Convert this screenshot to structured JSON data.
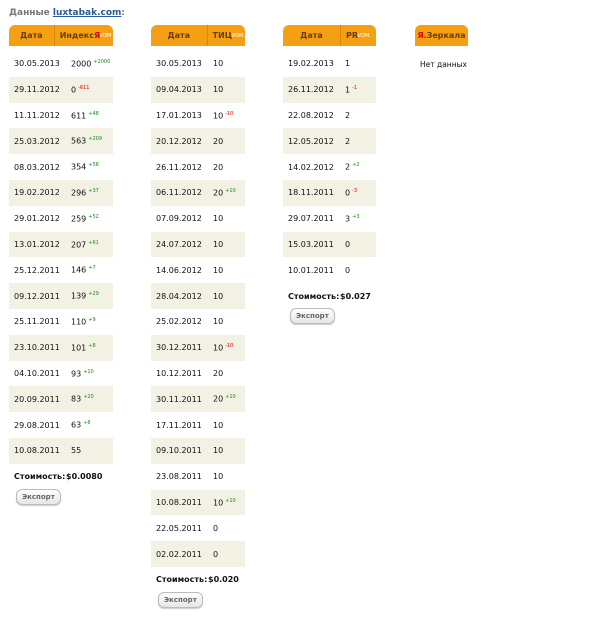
{
  "title": {
    "prefix": "Данные",
    "domain": "luxtabak.com",
    "suffix": ":"
  },
  "tables": [
    {
      "h1": "Дата",
      "h2": "Индекс",
      "h2_ya": "Я",
      "sup": "ИЗМ.",
      "cost_label": "Стоимость:",
      "cost": "$0.0080",
      "export": "Экспорт",
      "rows": [
        [
          "30.05.2013",
          "2000",
          "+2000"
        ],
        [
          "29.11.2012",
          "0",
          "-611"
        ],
        [
          "11.11.2012",
          "611",
          "+48"
        ],
        [
          "25.03.2012",
          "563",
          "+209"
        ],
        [
          "08.03.2012",
          "354",
          "+58"
        ],
        [
          "19.02.2012",
          "296",
          "+37"
        ],
        [
          "29.01.2012",
          "259",
          "+52"
        ],
        [
          "13.01.2012",
          "207",
          "+61"
        ],
        [
          "25.12.2011",
          "146",
          "+7"
        ],
        [
          "09.12.2011",
          "139",
          "+29"
        ],
        [
          "25.11.2011",
          "110",
          "+9"
        ],
        [
          "23.10.2011",
          "101",
          "+8"
        ],
        [
          "04.10.2011",
          "93",
          "+10"
        ],
        [
          "20.09.2011",
          "83",
          "+20"
        ],
        [
          "29.08.2011",
          "63",
          "+8"
        ],
        [
          "10.08.2011",
          "55",
          ""
        ]
      ]
    },
    {
      "h1": "Дата",
      "h2": "ТИЦ",
      "h2_ya": "",
      "sup": "ИЗМ.",
      "cost_label": "Стоимость:",
      "cost": "$0.020",
      "export": "Экспорт",
      "rows": [
        [
          "30.05.2013",
          "10",
          ""
        ],
        [
          "09.04.2013",
          "10",
          ""
        ],
        [
          "17.01.2013",
          "10",
          "-10"
        ],
        [
          "20.12.2012",
          "20",
          ""
        ],
        [
          "26.11.2012",
          "20",
          ""
        ],
        [
          "06.11.2012",
          "20",
          "+10"
        ],
        [
          "07.09.2012",
          "10",
          ""
        ],
        [
          "24.07.2012",
          "10",
          ""
        ],
        [
          "14.06.2012",
          "10",
          ""
        ],
        [
          "28.04.2012",
          "10",
          ""
        ],
        [
          "25.02.2012",
          "10",
          ""
        ],
        [
          "30.12.2011",
          "10",
          "-10"
        ],
        [
          "10.12.2011",
          "20",
          ""
        ],
        [
          "30.11.2011",
          "20",
          "+10"
        ],
        [
          "17.11.2011",
          "10",
          ""
        ],
        [
          "09.10.2011",
          "10",
          ""
        ],
        [
          "23.08.2011",
          "10",
          ""
        ],
        [
          "10.08.2011",
          "10",
          "+10"
        ],
        [
          "22.05.2011",
          "0",
          ""
        ],
        [
          "02.02.2011",
          "0",
          ""
        ]
      ]
    },
    {
      "h1": "Дата",
      "h2": "PR",
      "h2_ya": "",
      "sup": "ИЗМ.",
      "cost_label": "Стоимость:",
      "cost": "$0.027",
      "export": "Экспорт",
      "rows": [
        [
          "19.02.2013",
          "1",
          ""
        ],
        [
          "26.11.2012",
          "1",
          "-1"
        ],
        [
          "22.08.2012",
          "2",
          ""
        ],
        [
          "12.05.2012",
          "2",
          ""
        ],
        [
          "14.02.2012",
          "2",
          "+2"
        ],
        [
          "18.11.2011",
          "0",
          "-3"
        ],
        [
          "29.07.2011",
          "3",
          "+3"
        ],
        [
          "15.03.2011",
          "0",
          ""
        ],
        [
          "10.01.2011",
          "0",
          ""
        ]
      ]
    }
  ],
  "mirrors": {
    "ya": "Я.",
    "label": "Зеркала",
    "empty": "Нет данных"
  }
}
